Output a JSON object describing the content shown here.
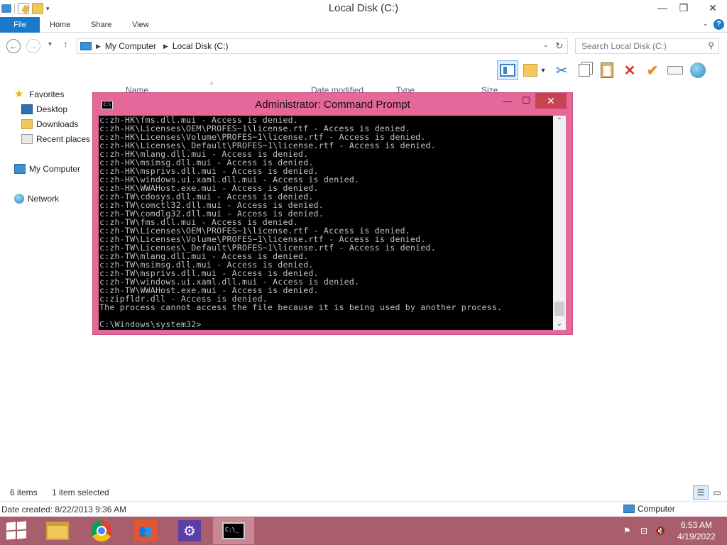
{
  "explorer": {
    "title": "Local Disk (C:)",
    "ribbon_tabs": [
      "File",
      "Home",
      "Share",
      "View"
    ],
    "help_label": "?",
    "breadcrumb": [
      "My Computer",
      "Local Disk (C:)"
    ],
    "search_placeholder": "Search Local Disk (C:)",
    "nav": {
      "favorites": "Favorites",
      "desktop": "Desktop",
      "downloads": "Downloads",
      "recent": "Recent places",
      "computer": "My Computer",
      "network": "Network"
    },
    "columns": [
      "Name",
      "Date modified",
      "Type",
      "Size"
    ],
    "status": {
      "items": "6 items",
      "selected": "1 item selected",
      "date_created": "Date created: 8/22/2013 9:36 AM",
      "location": "Computer"
    }
  },
  "cmd": {
    "title": "Administrator: Command Prompt",
    "lines": [
      "c:zh-HK\\fms.dll.mui - Access is denied.",
      "c:zh-HK\\Licenses\\OEM\\PROFES~1\\license.rtf - Access is denied.",
      "c:zh-HK\\Licenses\\Volume\\PROFES~1\\license.rtf - Access is denied.",
      "c:zh-HK\\Licenses\\_Default\\PROFES~1\\license.rtf - Access is denied.",
      "c:zh-HK\\mlang.dll.mui - Access is denied.",
      "c:zh-HK\\msimsg.dll.mui - Access is denied.",
      "c:zh-HK\\msprivs.dll.mui - Access is denied.",
      "c:zh-HK\\windows.ui.xaml.dll.mui - Access is denied.",
      "c:zh-HK\\WWAHost.exe.mui - Access is denied.",
      "c:zh-TW\\cdosys.dll.mui - Access is denied.",
      "c:zh-TW\\comctl32.dll.mui - Access is denied.",
      "c:zh-TW\\comdlg32.dll.mui - Access is denied.",
      "c:zh-TW\\fms.dll.mui - Access is denied.",
      "c:zh-TW\\Licenses\\OEM\\PROFES~1\\license.rtf - Access is denied.",
      "c:zh-TW\\Licenses\\Volume\\PROFES~1\\license.rtf - Access is denied.",
      "c:zh-TW\\Licenses\\_Default\\PROFES~1\\license.rtf - Access is denied.",
      "c:zh-TW\\mlang.dll.mui - Access is denied.",
      "c:zh-TW\\msimsg.dll.mui - Access is denied.",
      "c:zh-TW\\msprivs.dll.mui - Access is denied.",
      "c:zh-TW\\windows.ui.xaml.dll.mui - Access is denied.",
      "c:zh-TW\\WWAHost.exe.mui - Access is denied.",
      "c:zipfldr.dll - Access is denied.",
      "The process cannot access the file because it is being used by another process.",
      "",
      "C:\\Windows\\system32>"
    ]
  },
  "taskbar": {
    "time": "6:53 AM",
    "date": "4/19/2022",
    "apps": [
      "file-explorer",
      "chrome",
      "people",
      "settings",
      "command-prompt"
    ]
  },
  "colors": {
    "cmd_frame": "#e6679a",
    "taskbar": "#a85e6c",
    "ribbon_file": "#1979ca"
  }
}
